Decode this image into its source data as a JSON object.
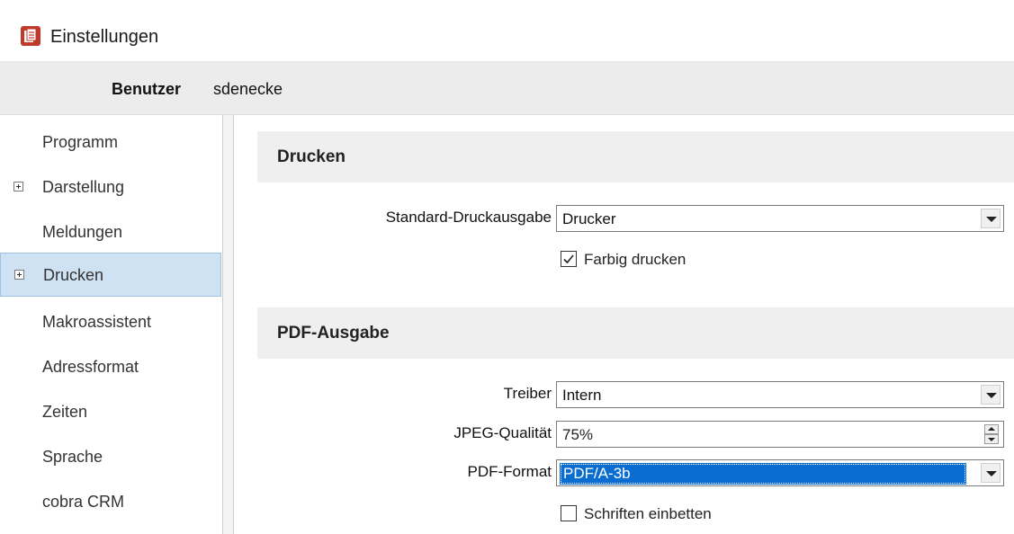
{
  "window": {
    "title": "Einstellungen",
    "icon": "settings-app-icon"
  },
  "user": {
    "label": "Benutzer",
    "name": "sdenecke"
  },
  "sidebar": {
    "items": [
      {
        "label": "Programm",
        "expandable": false
      },
      {
        "label": "Darstellung",
        "expandable": true
      },
      {
        "label": "Meldungen",
        "expandable": false
      },
      {
        "label": "Drucken",
        "expandable": true,
        "selected": true
      },
      {
        "label": "Makroassistent",
        "expandable": false
      },
      {
        "label": "Adressformat",
        "expandable": false
      },
      {
        "label": "Zeiten",
        "expandable": false
      },
      {
        "label": "Sprache",
        "expandable": false
      },
      {
        "label": "cobra CRM",
        "expandable": false
      }
    ]
  },
  "drucken": {
    "header": "Drucken",
    "standard_label": "Standard-Druckausgabe",
    "standard_value": "Drucker",
    "farbig_label": "Farbig drucken",
    "farbig_checked": true
  },
  "pdf": {
    "header": "PDF-Ausgabe",
    "treiber_label": "Treiber",
    "treiber_value": "Intern",
    "jpeg_label": "JPEG-Qualität",
    "jpeg_value": "75%",
    "format_label": "PDF-Format",
    "format_value": "PDF/A-3b",
    "schriften_label": "Schriften einbetten",
    "schriften_checked": false
  },
  "colors": {
    "selection": "#0a6ed1",
    "nav_selected": "#cfe2f4",
    "header_bg": "#efefef"
  }
}
